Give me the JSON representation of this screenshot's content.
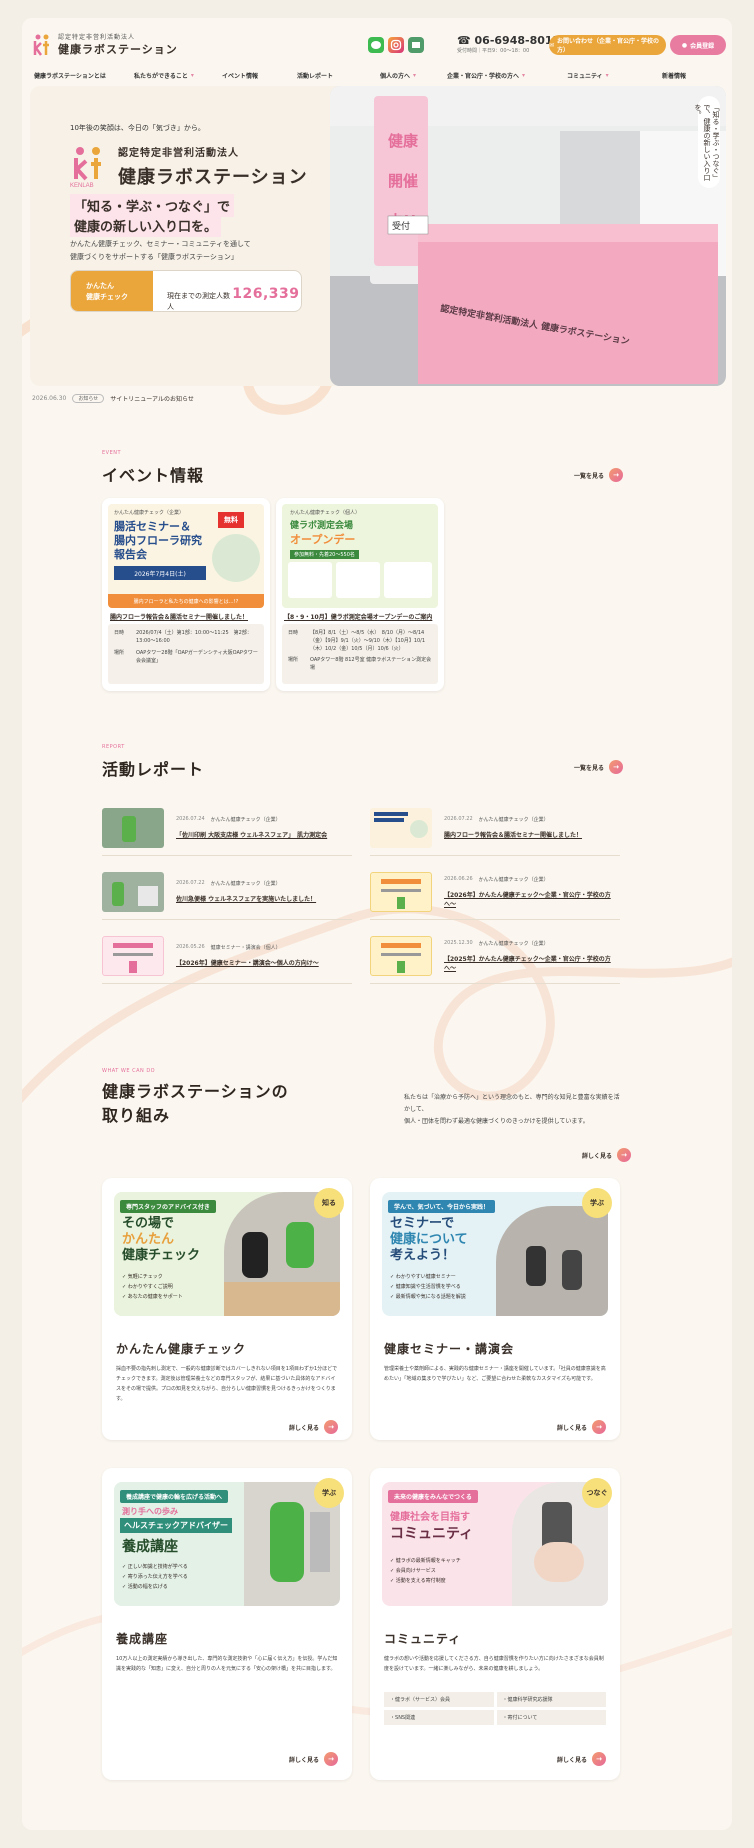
{
  "header": {
    "logo_sub": "認定特定非営利活動法人",
    "logo_name": "健康ラボステーション",
    "phone": "06-6948-8015",
    "phone_hours": "受付時間｜平日9：00〜18：00",
    "contact_label": "お問い合わせ（企業・官公庁・学校の方）",
    "member_label": "会員登録"
  },
  "nav": [
    {
      "label": "健康ラボステーションとは"
    },
    {
      "label": "私たちができること"
    },
    {
      "label": "イベント情報"
    },
    {
      "label": "活動レポート"
    },
    {
      "label": "個人の方へ"
    },
    {
      "label": "企業・官公庁・学校の方へ"
    },
    {
      "label": "コミュニティ"
    },
    {
      "label": "新着情報"
    }
  ],
  "hero": {
    "tag": "10年後の笑顔は、今日の「気づき」から。",
    "org_sub": "認定特定非営利活動法人",
    "org_name": "健康ラボステーション",
    "logo_caption": "KENLAB",
    "catch1": "「知る・学ぶ・つなぐ」で",
    "catch2": "健康の新しい入り口を。",
    "desc1": "かんたん健康チェック、セミナー・コミュニティを通して",
    "desc2": "健康づくりをサポートする「健康ラボステーション」",
    "cta_label1": "かんたん",
    "cta_label2": "健康チェック",
    "count_label": "現在までの測定人数",
    "count_value": "126,339",
    "count_unit": "人",
    "vertical_copy": "「知る・学ぶ・つなぐ」で、健康の新しい入り口を。",
    "banner_text": "健康フェア 開催中!!",
    "banner_sub": "受付",
    "table_text": "認定特定非営利活動法人 健康ラボステーション"
  },
  "news": {
    "date": "2026.06.30",
    "tag": "お知らせ",
    "title": "サイトリニューアルのお知らせ"
  },
  "events": {
    "en": "EVENT",
    "title": "イベント情報",
    "more": "一覧を見る",
    "items": [
      {
        "img_label": "かんたん健康チェック（企業）",
        "img_title1": "腸活セミナー＆",
        "img_title2": "腸内フローラ研究",
        "img_title3": "報告会",
        "img_free": "無料",
        "img_date": "2026年7月4日(土)",
        "img_foot": "腸内フローラと私たちの健康への影響とは…!?",
        "title": "腸内フローラ報告会＆腸活セミナー開催しました！",
        "rows": [
          {
            "k": "日時",
            "v": "2026/07/4（土）第1部：10:00〜11:25　第2部：13:00〜16:00"
          },
          {
            "k": "場所",
            "v": "OAPタワー28階「OAPガーデンシティ大阪OAPタワー 会会議室」"
          }
        ]
      },
      {
        "img_label": "かんたん健康チェック（個人）",
        "img_title1": "健ラボ測定会場",
        "img_title2": "オープンデー",
        "img_sub": "参加無料・先着20～550名",
        "title": "【8・9・10月】健ラボ測定会場オープンデーのご案内",
        "rows": [
          {
            "k": "日時",
            "v": "【8月】8/1（土）〜8/5（水）　8/10（月）〜8/14（金）【9月】9/1（火）〜9/10（木）【10月】10/1（木）10/2（金）10/5（月）10/6（火）"
          },
          {
            "k": "場所",
            "v": "OAPタワー8階 812号室 健康ラボステーション測定会場"
          }
        ]
      }
    ]
  },
  "reports": {
    "en": "REPORT",
    "title": "活動レポート",
    "more": "一覧を見る",
    "items": [
      {
        "date": "2026.07.24",
        "cat": "かんたん健康チェック（企業）",
        "title": "「佐川印刷 大阪支店様 ウェルネスフェア」　肌力測定会"
      },
      {
        "date": "2026.07.22",
        "cat": "かんたん健康チェック（企業）",
        "title": "腸内フローラ報告会＆腸活セミナー開催しました！"
      },
      {
        "date": "2026.07.22",
        "cat": "かんたん健康チェック（企業）",
        "title": "佐川急便様 ウェルネスフェアを実施いたしました！"
      },
      {
        "date": "2026.06.26",
        "cat": "かんたん健康チェック（企業）",
        "title": "【2026年】かんたん健康チェック〜企業・官公庁・学校の方へ〜"
      },
      {
        "date": "2026.05.26",
        "cat": "健康セミナー・講演会（個人）",
        "title": "【2026年】健康セミナー・講演会〜個人の方向け〜"
      },
      {
        "date": "2025.12.30",
        "cat": "かんたん健康チェック（企業）",
        "title": "【2025年】かんたん健康チェック〜企業・官公庁・学校の方へ〜"
      }
    ]
  },
  "works": {
    "en": "WHAT WE CAN DO",
    "title1": "健康ラボステーションの",
    "title2": "取り組み",
    "intro1": "私たちは「治療から予防へ」という理念のもと、専門的な知見と豊富な実績を活かして、",
    "intro2": "個人・団体を問わず最適な健康づくりのきっかけを提供しています。",
    "more": "詳しく見る",
    "cards": [
      {
        "badge": "知る",
        "img_head": "専門スタッフのアドバイス付き",
        "img_big1": "その場で",
        "img_big2": "かんたん",
        "img_big3": "健康チェック",
        "bullets": [
          "気軽にチェック",
          "わかりやすくご説明",
          "あなたの健康をサポート"
        ],
        "title": "かんたん健康チェック",
        "desc": "採血不要の指先刺し測定で、一般的な健康診断ではカバーしきれない項目を1項目わずか1分ほどでチェックできます。測定後は管理栄養士などの専門スタッフが、結果に基づいた具体的なアドバイスをその場で提供。プロの知見を交えながら、自分らしい健康習慣を見つけるきっかけをつくります。",
        "more": "詳しく見る"
      },
      {
        "badge": "学ぶ",
        "img_head": "学んで、気づいて、今日から実践！",
        "img_big1": "セミナーで",
        "img_big2": "健康について",
        "img_big3": "考えよう！",
        "bullets": [
          "わかりやすい健康セミナー",
          "健康知識や生活習慣を学べる",
          "最新情報や気になる話題を解説"
        ],
        "title": "健康セミナー・講演会",
        "desc": "管理栄養士や薬剤師による、実践的な健康セミナー・講座を開催しています。「社員の健康意識を高めたい」「地域の集まりで学びたい」など、ご要望に合わせた柔軟なカスタマイズも可能です。",
        "more": "詳しく見る"
      },
      {
        "badge": "学ぶ",
        "img_head": "養成講座で健康の輪を広げる活動へ",
        "img_big1": "測り手への歩み",
        "img_big2": "ヘルスチェックアドバイザー",
        "img_big3": "養成講座",
        "bullets": [
          "正しい知識と技術が学べる",
          "寄り添った伝え方を学べる",
          "活動の幅を広げる"
        ],
        "title": "養成講座",
        "desc": "10万人以上の測定実績から導き出した、専門的な測定技術や「心に届く伝え方」を伝授。学んだ知識を実践的な「知恵」に変え、自分と周りの人を元気にする「安心の架け橋」を共に目指します。",
        "more": "詳しく見る"
      },
      {
        "badge": "つなぐ",
        "img_head": "未来の健康をみんなでつくる",
        "img_big1": "健康社会を目指す",
        "img_big2": "コミュニティ",
        "img_big3": "",
        "bullets": [
          "健ラボの最新情報をキャッチ",
          "会員向けサービス",
          "活動を支える寄付制度"
        ],
        "title": "コミュニティ",
        "desc": "健ラボの想いや活動を応援してくださる方、自ら健康習慣を作りたい方に向けたさまざまな会員制度を設けています。一緒に楽しみながら、未来の健康を耕しましょう。",
        "tags": [
          "健ラボ（サービス）会員",
          "健康科学研究応援隊",
          "SNS関連",
          "寄付について"
        ],
        "more": "詳しく見る"
      }
    ]
  },
  "colors": {
    "accent_pink": "#e56f9b",
    "accent_orange": "#eaa53b",
    "background": "#fbf7f0"
  }
}
